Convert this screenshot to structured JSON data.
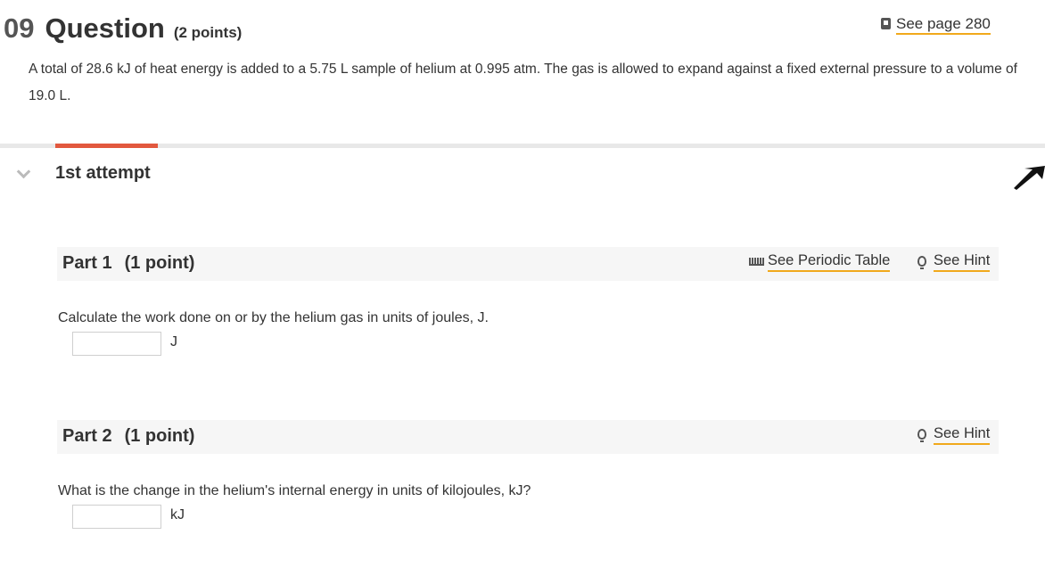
{
  "question": {
    "number": "09",
    "title": "Question",
    "points": "(2 points)",
    "book_link": "See page 280",
    "stem": "A total of 28.6  kJ of heat energy is added to a 5.75 L sample of helium at 0.995  atm. The gas is allowed to expand against a fixed external pressure to a volume of 19.0  L."
  },
  "attempt": {
    "label": "1st attempt"
  },
  "parts": [
    {
      "title": "Part 1",
      "points": "(1 point)",
      "periodic_table_link": "See Periodic Table",
      "hint_link": "See Hint",
      "prompt": "Calculate the work done on or by the helium gas in units of joules, J.",
      "answer_value": "",
      "unit": "J"
    },
    {
      "title": "Part 2",
      "points": "(1 point)",
      "hint_link": "See Hint",
      "prompt": "What is the change in the helium's internal energy in units of kilojoules, kJ?",
      "answer_value": "",
      "unit": "kJ"
    }
  ],
  "colors": {
    "accent_orange": "#e2583e",
    "link_underline": "#f1a91c",
    "part_bar": "#f6f6f6"
  },
  "icons": {
    "book": "book-icon",
    "periodic": "periodic-table-icon",
    "hint": "lightbulb-icon",
    "collapse": "chevron-down-icon",
    "cursor": "mouse-cursor-icon"
  }
}
